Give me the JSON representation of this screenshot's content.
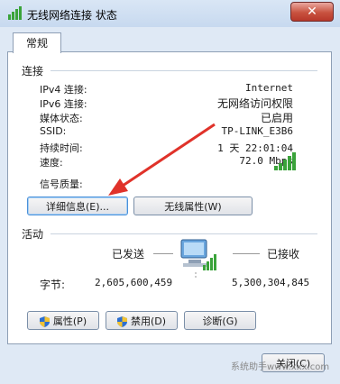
{
  "window": {
    "title": "无线网络连接 状态",
    "close_label": "✕"
  },
  "tab": {
    "label": "常规"
  },
  "connection": {
    "section_label": "连接",
    "rows": [
      {
        "label": "IPv4 连接:",
        "value": "Internet"
      },
      {
        "label": "IPv6 连接:",
        "value": "无网络访问权限"
      },
      {
        "label": "媒体状态:",
        "value": "已启用"
      },
      {
        "label": "SSID:",
        "value": "TP-LINK_E3B6"
      },
      {
        "label": "持续时间:",
        "value": "1 天 22:01:04"
      },
      {
        "label": "速度:",
        "value": "72.0 Mbps"
      }
    ],
    "signal_label": "信号质量:",
    "signal_level_bars": 5,
    "details_button": "详细信息(E)...",
    "wireless_props_button": "无线属性(W)"
  },
  "activity": {
    "section_label": "活动",
    "sent_label": "已发送",
    "received_label": "已接收",
    "bytes_label": "字节:",
    "bytes_sent": "2,605,600,459",
    "bytes_received": "5,300,304,845"
  },
  "buttons": {
    "properties": "属性(P)",
    "disable": "禁用(D)",
    "diagnose": "诊断(G)",
    "close": "关闭(C)"
  },
  "watermark": "系统助手www.xxx.com",
  "icons": {
    "title": "wireless-network-icon",
    "shield": "uac-shield-icon",
    "network": "network-computers-icon"
  },
  "colors": {
    "signal": "#3aa33a",
    "arrow": "#e0322a"
  }
}
